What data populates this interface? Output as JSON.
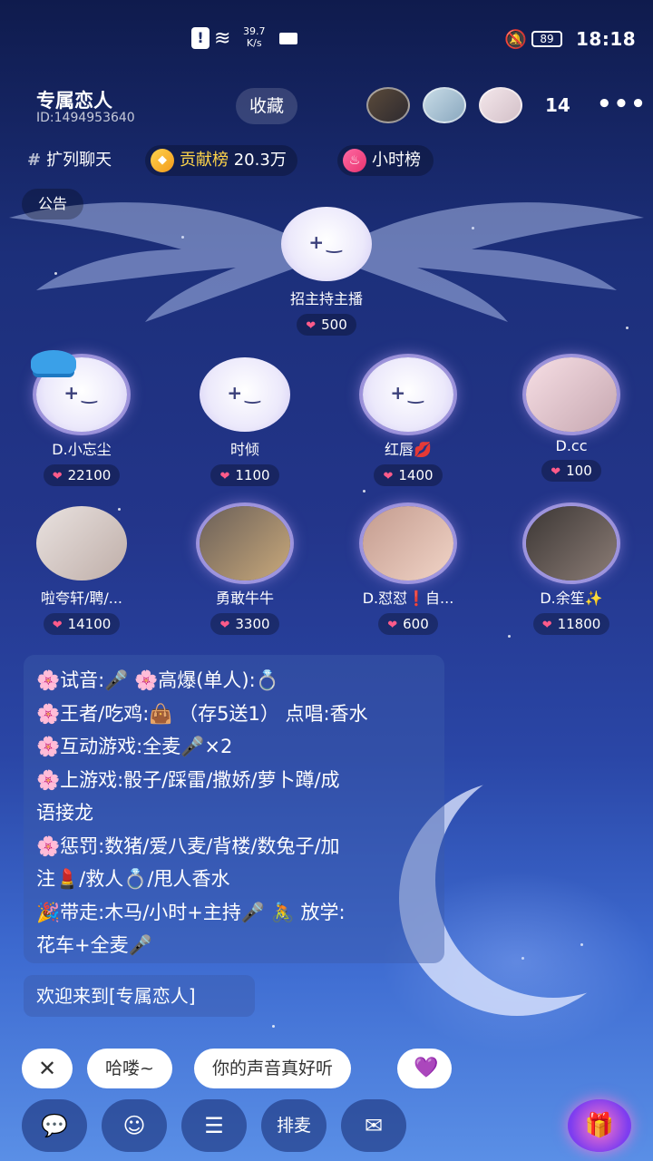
{
  "status_bar": {
    "net_speed_value": "39.7",
    "net_speed_unit": "K/s",
    "battery": "89",
    "time": "18:18"
  },
  "header": {
    "room_title": "专属恋人",
    "room_id": "ID:1494953640",
    "favorite_label": "收藏",
    "online_count": "14",
    "more_label": "•••"
  },
  "tags": {
    "topic_hash": "#",
    "topic": "扩列聊天",
    "contribution_label": "贡献榜",
    "contribution_value": "20.3万",
    "hourly_label": "小时榜",
    "notice_label": "公告"
  },
  "host_seat": {
    "name": "招主持主播",
    "score": "500"
  },
  "seats": [
    {
      "name": "D.小忘尘",
      "score": "22100"
    },
    {
      "name": "时倾",
      "score": "1100"
    },
    {
      "name": "红唇💋",
      "score": "1400"
    },
    {
      "name": "D.cc",
      "score": "100"
    },
    {
      "name": "啦夸轩/聘/...",
      "score": "14100"
    },
    {
      "name": "勇敢牛牛",
      "score": "3300"
    },
    {
      "name": "D.怼怼❗自...",
      "score": "600"
    },
    {
      "name": "D.余笙✨",
      "score": "11800"
    }
  ],
  "info_panel": {
    "lines": [
      "🌸试音:🎤 🌸高爆(单人):💍",
      "🌸王者/吃鸡:👜 （存5送1） 点唱:香水",
      "🌸互动游戏:全麦🎤×2",
      "🌸上游戏:骰子/踩雷/撒娇/萝卜蹲/成",
      "语接龙",
      "🌸惩罚:数猪/爱八麦/背楼/数兔子/加",
      "注💄/救人💍/甩人香水",
      "🎉带走:木马/小时+主持🎤 🚴 放学:",
      "花车+全麦🎤"
    ]
  },
  "welcome": "欢迎来到[专属恋人]",
  "quick_replies": {
    "close_label": "✕",
    "items": [
      "哈喽~",
      "你的声音真好听",
      "💜"
    ]
  },
  "bottom_bar": {
    "mic_queue_label": "排麦"
  },
  "colors": {
    "accent_pink": "#ff5b8a",
    "gold": "#ffd54a",
    "bg_top": "#0f1b4d",
    "bg_bottom": "#5a8fe6"
  }
}
